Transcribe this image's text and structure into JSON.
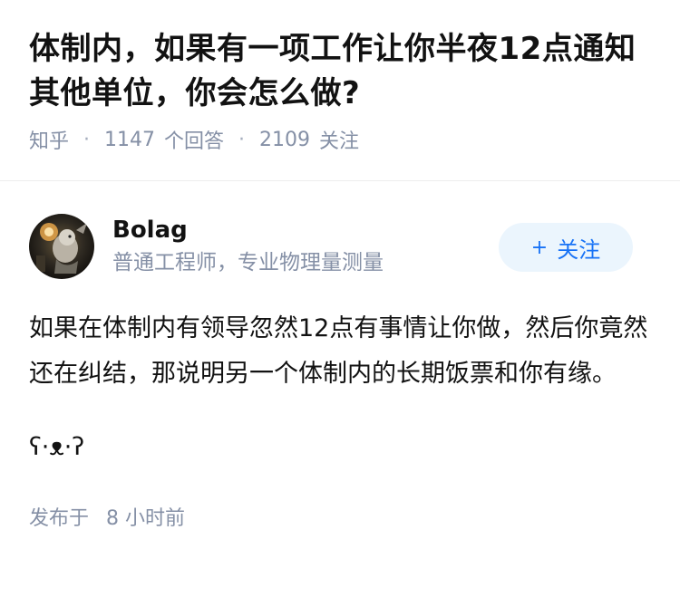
{
  "question": {
    "title": "体制内，如果有一项工作让你半夜12点通知其他单位，你会怎么做?",
    "source": "知乎",
    "answers_count": "1147",
    "answers_label": "个回答",
    "followers_count": "2109",
    "followers_label": "关注"
  },
  "answer": {
    "author_name": "Bolag",
    "author_bio": "普通工程师，专业物理量测量",
    "follow_label": "关注",
    "follow_icon": "plus-icon",
    "content": "如果在体制内有领导忽然12点有事情让你做，然后你竟然还在纠结，那说明另一个体制内的长期饭票和你有缘。",
    "emoticon": "ʕ·ᴥ·ʔ",
    "posted_label": "发布于",
    "posted_time": "8 小时前"
  },
  "colors": {
    "accent": "#1772f6",
    "follow_bg": "#ebf5fd",
    "meta_text": "#8590a6"
  }
}
